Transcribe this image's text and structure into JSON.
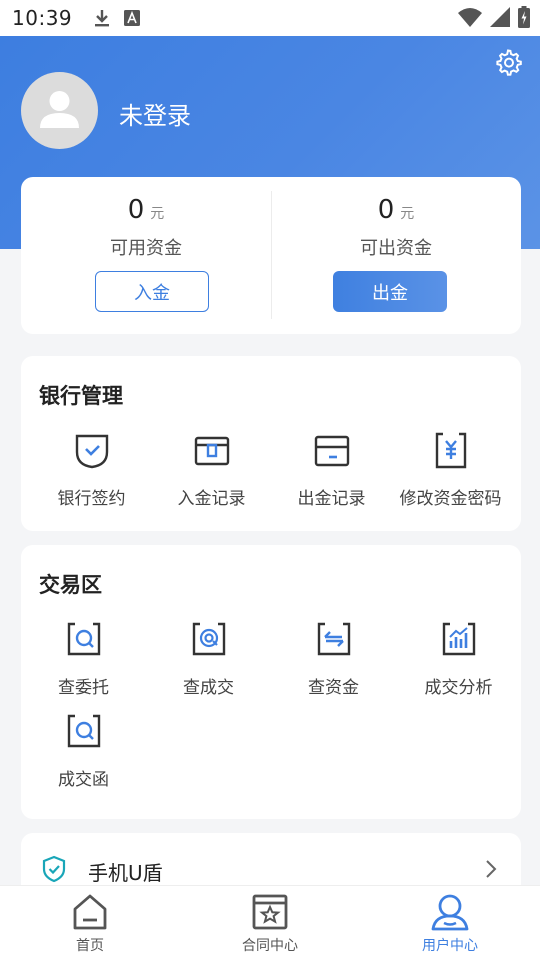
{
  "status_bar": {
    "time": "10:39",
    "icons": [
      "download-icon",
      "a-icon",
      "wifi-icon",
      "signal-icon",
      "battery-icon"
    ]
  },
  "header": {
    "login_status": "未登录",
    "settings_icon": "gear-icon"
  },
  "funds": {
    "available": {
      "amount": "0",
      "unit": "元",
      "label": "可用资金",
      "button": "入金"
    },
    "withdrawable": {
      "amount": "0",
      "unit": "元",
      "label": "可出资金",
      "button": "出金"
    }
  },
  "bank_management": {
    "title": "银行管理",
    "items": [
      {
        "label": "银行签约",
        "icon": "shield-check-icon"
      },
      {
        "label": "入金记录",
        "icon": "deposit-record-icon"
      },
      {
        "label": "出金记录",
        "icon": "withdraw-record-icon"
      },
      {
        "label": "修改资金密码",
        "icon": "yuan-document-icon"
      }
    ]
  },
  "trade_area": {
    "title": "交易区",
    "items": [
      {
        "label": "查委托",
        "icon": "search-frame-icon"
      },
      {
        "label": "查成交",
        "icon": "target-frame-icon"
      },
      {
        "label": "查资金",
        "icon": "money-frame-icon"
      },
      {
        "label": "成交分析",
        "icon": "chart-frame-icon"
      },
      {
        "label": "成交函",
        "icon": "search-frame-icon"
      }
    ]
  },
  "ushield": {
    "label": "手机U盾",
    "icon": "shield-check-icon"
  },
  "bottom_nav": {
    "items": [
      {
        "label": "首页",
        "icon": "home-icon"
      },
      {
        "label": "合同中心",
        "icon": "contract-icon"
      },
      {
        "label": "用户中心",
        "icon": "user-icon",
        "active": true
      }
    ]
  },
  "colors": {
    "primary": "#3e7fe0",
    "accent_teal": "#19a6b8"
  }
}
